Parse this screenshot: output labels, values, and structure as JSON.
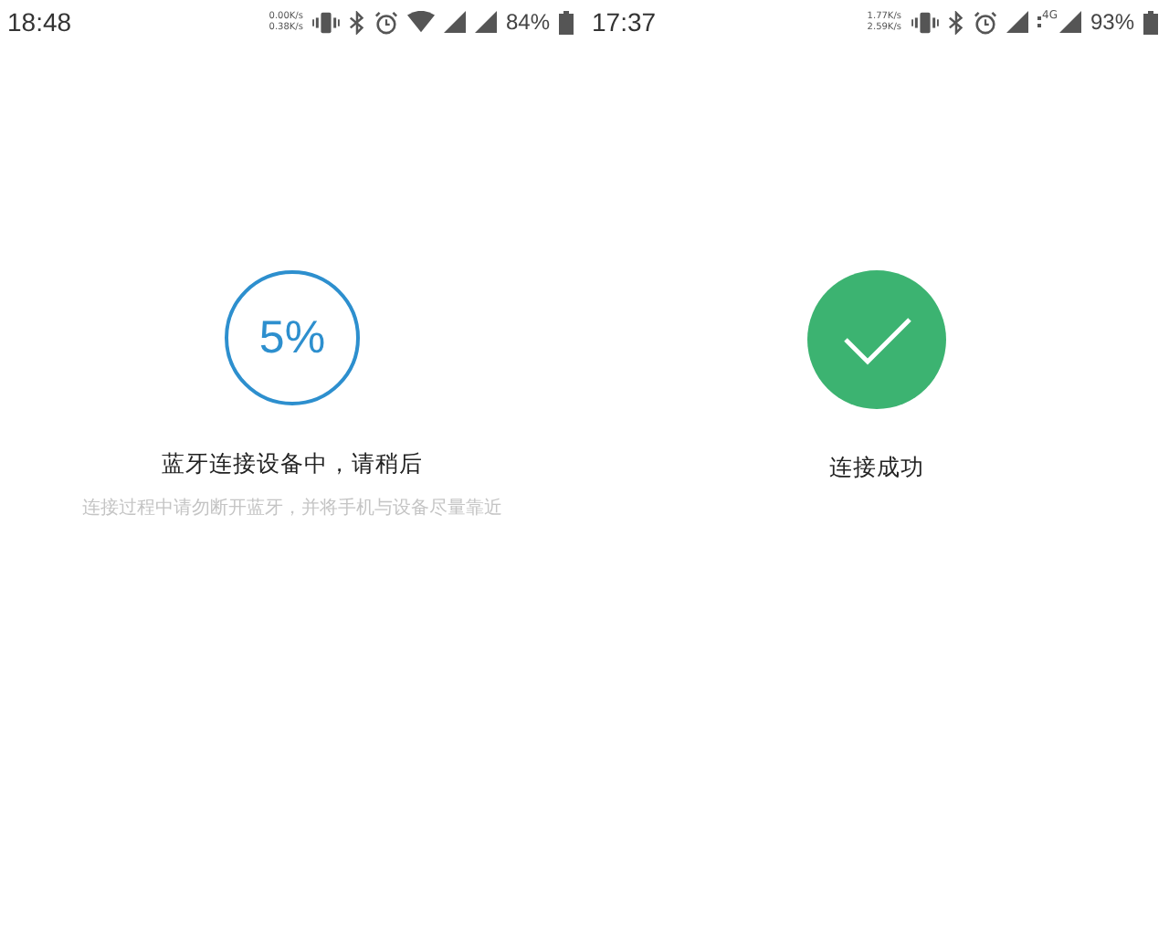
{
  "screens": [
    {
      "status_bar": {
        "time": "18:48",
        "speed_up": "0.00K/s",
        "speed_down": "0.38K/s",
        "icons": [
          {
            "kind": "vibrate"
          },
          {
            "kind": "bluetooth"
          },
          {
            "kind": "alarm"
          },
          {
            "kind": "wifi"
          },
          {
            "kind": "signal"
          },
          {
            "kind": "signal"
          }
        ],
        "battery": "84%"
      },
      "status": {
        "kind": "progress",
        "value": "5%"
      },
      "title": "蓝牙连接设备中，请稍后",
      "subtitle": "连接过程中请勿断开蓝牙，并将手机与设备尽量靠近"
    },
    {
      "status_bar": {
        "time": "17:37",
        "speed_up": "1.77K/s",
        "speed_down": "2.59K/s",
        "icons": [
          {
            "kind": "vibrate"
          },
          {
            "kind": "bluetooth"
          },
          {
            "kind": "alarm"
          },
          {
            "kind": "signal"
          },
          {
            "kind": "signal4g",
            "label": "4G"
          }
        ],
        "battery": "93%"
      },
      "status": {
        "kind": "success"
      },
      "title": "连接成功"
    }
  ]
}
